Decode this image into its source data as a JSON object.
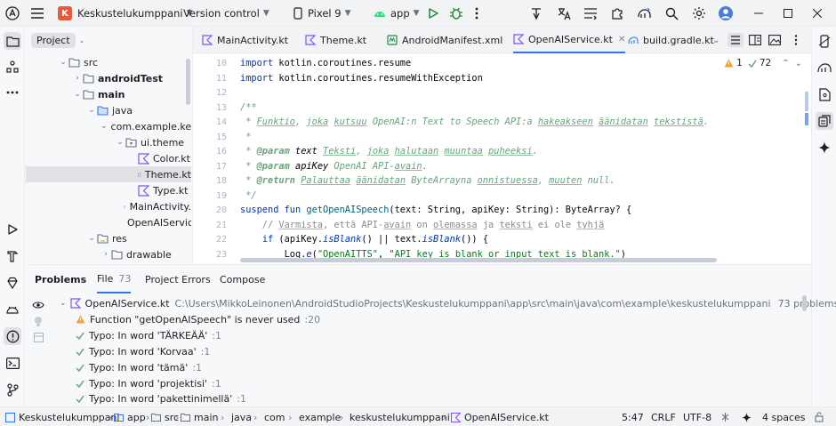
{
  "titlebar": {
    "project_badge": "K",
    "project_name": "Keskustelukumppani",
    "vcs": "Version control",
    "device": "Pixel 9",
    "run_config": "app",
    "badge_color": "#e55b3c"
  },
  "project_panel": {
    "title": "Project",
    "tree": [
      {
        "label": "src"
      },
      {
        "label": "androidTest"
      },
      {
        "label": "main"
      },
      {
        "label": "java"
      },
      {
        "label": "com.example.ke"
      },
      {
        "label": "ui.theme"
      },
      {
        "label": "Color.kt"
      },
      {
        "label": "Theme.kt"
      },
      {
        "label": "Type.kt"
      },
      {
        "label": "MainActivity."
      },
      {
        "label": "OpenAIServic"
      },
      {
        "label": "res"
      },
      {
        "label": "drawable"
      }
    ]
  },
  "tabs": [
    {
      "label": "MainActivity.kt"
    },
    {
      "label": "Theme.kt"
    },
    {
      "label": "AndroidManifest.xml"
    },
    {
      "label": "OpenAIService.kt"
    },
    {
      "label": "build.gradle.kt"
    }
  ],
  "editor": {
    "warning_count": "1",
    "typo_count": "72",
    "line_numbers": [
      "10",
      "11",
      "12",
      "13",
      "14",
      "15",
      "16",
      "17",
      "18",
      "19",
      "20",
      "21",
      "22",
      "23"
    ],
    "lines": {
      "l10_kw": "import",
      "l10_rest": " kotlin.coroutines.resume",
      "l11_kw": "import",
      "l11_rest": " kotlin.coroutines.resumeWithException",
      "l13": "/**",
      "l14_a": " * ",
      "l14_w1": "Funktio",
      "l14_b": ", ",
      "l14_w2": "joka",
      "l14_c": " ",
      "l14_w3": "kutsuu",
      "l14_d": " OpenAI:n Text to Speech API:a ",
      "l14_w4": "hakeakseen",
      "l14_e": " ",
      "l14_w5": "äänidatan",
      "l14_f": " ",
      "l14_w6": "tekstistä",
      "l14_g": ".",
      "l15": " *",
      "l16_a": " * ",
      "l16_tag": "@param",
      "l16_b": " ",
      "l16_p": "text",
      "l16_c": " ",
      "l16_w1": "Teksti",
      "l16_d": ", ",
      "l16_w2": "joka",
      "l16_e": " ",
      "l16_w3": "halutaan",
      "l16_f": " ",
      "l16_w4": "muuntaa",
      "l16_g": " ",
      "l16_w5": "puheeksi",
      "l16_h": ".",
      "l17_a": " * ",
      "l17_tag": "@param",
      "l17_b": " ",
      "l17_p": "apiKey",
      "l17_c": " OpenAI API-",
      "l17_w1": "avain",
      "l17_d": ".",
      "l18_a": " * ",
      "l18_tag": "@return",
      "l18_b": " ",
      "l18_w1": "Palauttaa",
      "l18_c": " ",
      "l18_w2": "äänidatan",
      "l18_d": " ByteArrayna ",
      "l18_w3": "onnistuessa",
      "l18_e": ", ",
      "l18_w4": "muuten",
      "l18_f": " null.",
      "l19": " */",
      "l20_kw": "suspend fun",
      "l20_fn": " getOpenAISpeech",
      "l20_rest": "(text: String, apiKey: String): ByteArray? {",
      "l21_a": "    // ",
      "l21_w1": "Varmista",
      "l21_b": ", että API-",
      "l21_w2": "avain",
      "l21_c": " on ",
      "l21_w3": "olemassa",
      "l21_d": " ja ",
      "l21_w4": "teksti",
      "l21_e": " ei ole ",
      "l21_w5": "tyhjä",
      "l22_a": "    ",
      "l22_kw": "if",
      "l22_b": " (apiKey.",
      "l22_f1": "isBlank",
      "l22_c": "() || text.",
      "l22_f2": "isBlank",
      "l22_d": "()) {",
      "l23_a": "        Log.",
      "l23_fn": "e",
      "l23_b": "(",
      "l23_s1": "\"OpenAITTS\"",
      "l23_c": ", ",
      "l23_s2": "\"API key is blank or input text is blank.\"",
      "l23_d": ")"
    }
  },
  "problems": {
    "tabs": [
      {
        "label": "Problems"
      },
      {
        "label": "File",
        "count": "73"
      },
      {
        "label": "Project Errors"
      },
      {
        "label": "Compose"
      }
    ],
    "file": {
      "name": "OpenAIService.kt",
      "path": "C:\\Users\\MikkoLeinonen\\AndroidStudioProjects\\Keskustelukumppani\\app\\src\\main\\java\\com\\example\\keskustelukumppani",
      "count": "73 problems"
    },
    "items": [
      {
        "text": "Function \"getOpenAISpeech\" is never used",
        "loc": ":20",
        "kind": "warning"
      },
      {
        "text": "Typo: In word 'TÄRKEÄÄ'",
        "loc": ":1",
        "kind": "typo"
      },
      {
        "text": "Typo: In word 'Korvaa'",
        "loc": ":1",
        "kind": "typo"
      },
      {
        "text": "Typo: In word 'tämä'",
        "loc": ":1",
        "kind": "typo"
      },
      {
        "text": "Typo: In word 'projektisi'",
        "loc": ":1",
        "kind": "typo"
      },
      {
        "text": "Typo: In word 'pakettinimellä'",
        "loc": ":1",
        "kind": "typo"
      }
    ]
  },
  "statusbar": {
    "breadcrumb": [
      "Keskustelukumppani",
      "app",
      "src",
      "main",
      "java",
      "com",
      "example",
      "keskustelukumppani",
      "OpenAIService.kt"
    ],
    "position": "5:47",
    "line_ending": "CRLF",
    "encoding": "UTF-8",
    "indent": "4 spaces"
  }
}
